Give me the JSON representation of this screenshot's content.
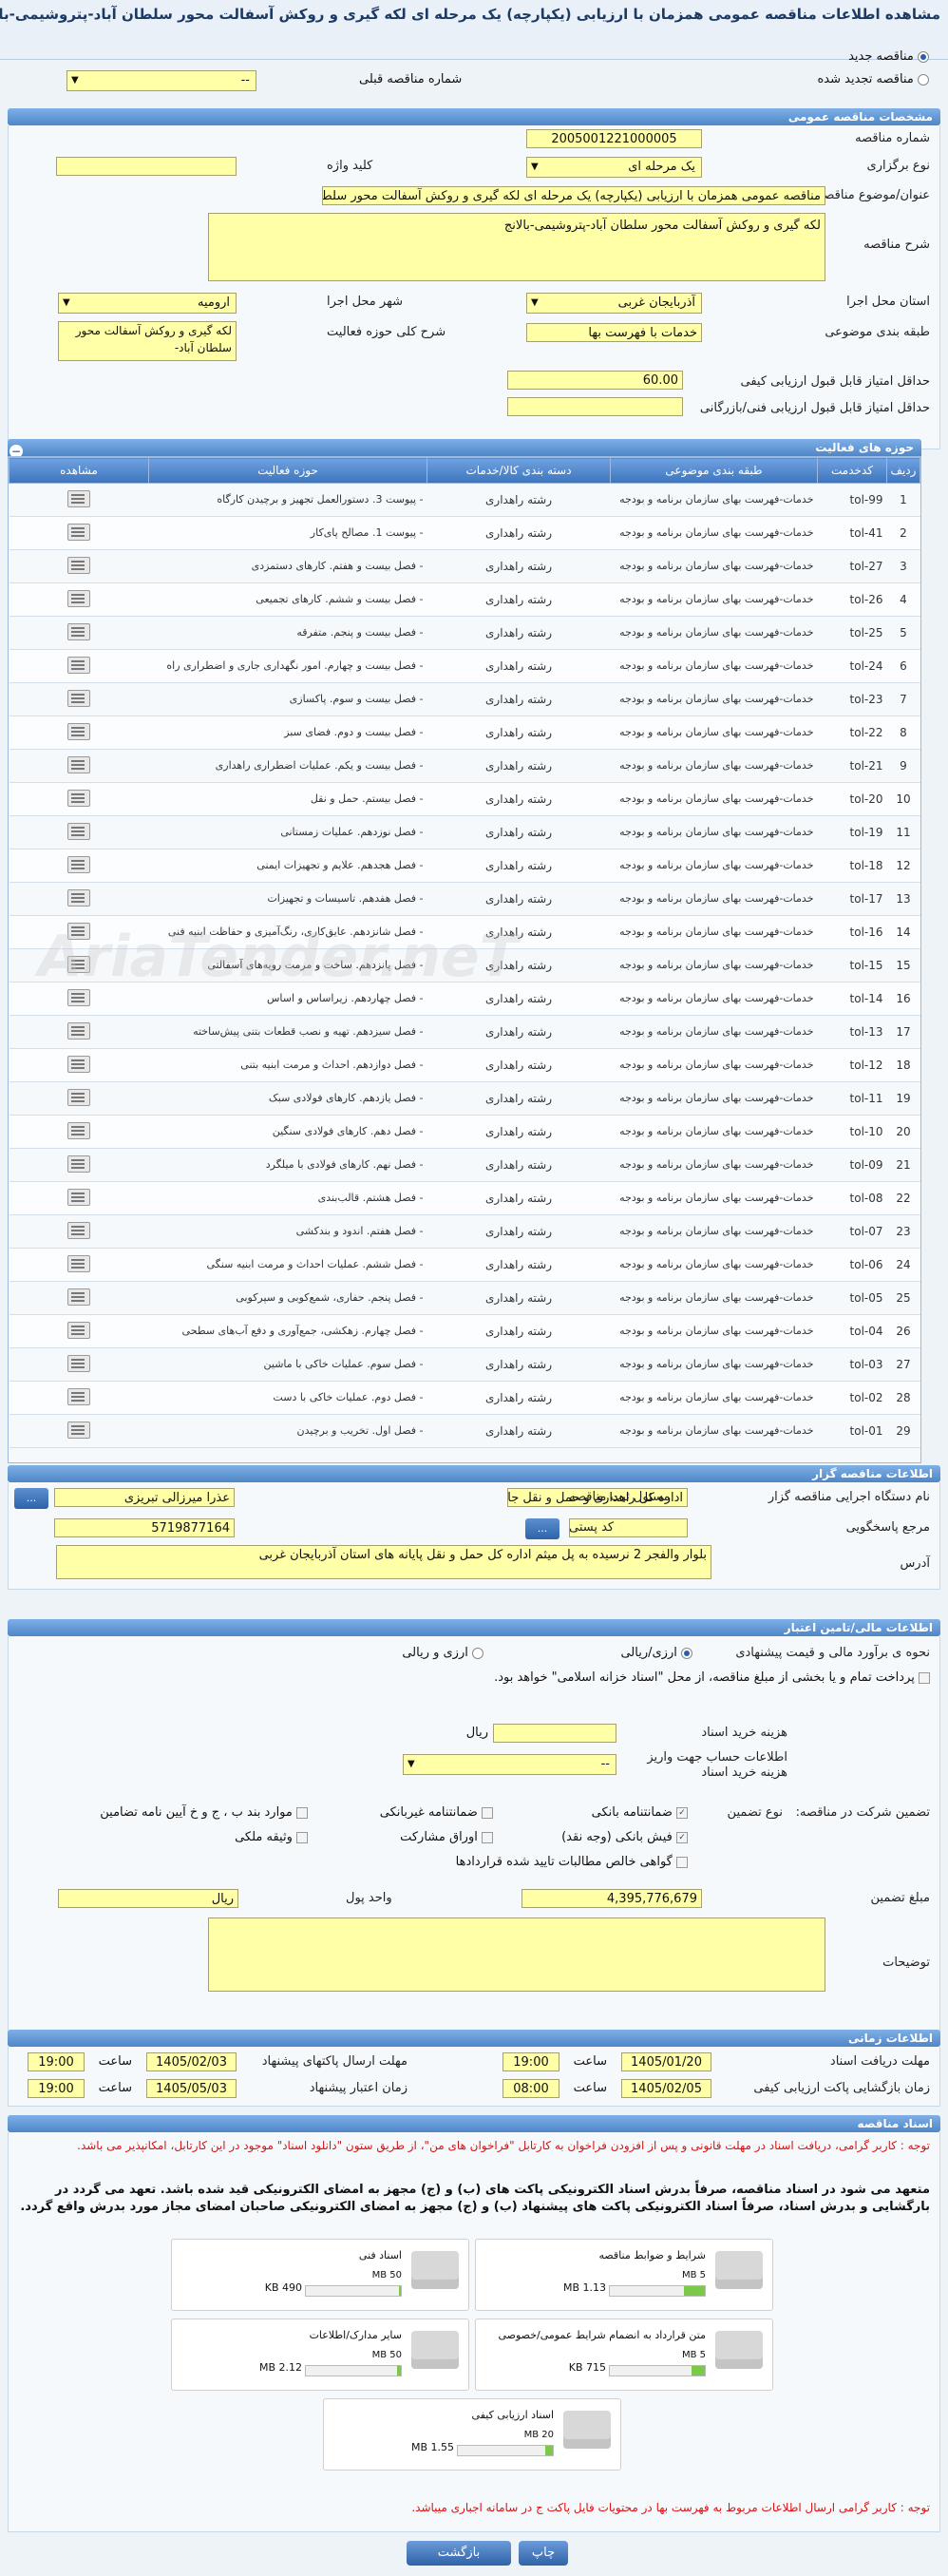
{
  "page_title": "مشاهده اطلاعات مناقصه عمومی همزمان با ارزیابی (یکپارچه) یک مرحله ای لکه گیری و روکش آسفالت محور سلطان آباد-پتروشیمی-بالانج",
  "top": {
    "new_tender_label": "مناقصه جدید",
    "renewed_tender_label": "مناقصه تجدید شده",
    "prev_tender_number_label": "شماره مناقصه قبلی",
    "prev_tender_value": "--"
  },
  "sections": {
    "general": "مشخصات مناقصه عمومی",
    "activities": "حوزه های فعالیت",
    "organizer": "اطلاعات مناقصه گزار",
    "financial": "اطلاعات مالی/تامین اعتبار",
    "timing": "اطلاعات زمانی",
    "docs": "اسناد مناقصه"
  },
  "general": {
    "tender_number_label": "شماره مناقصه",
    "tender_number": "2005001221000005",
    "holding_type_label": "نوع برگزاری",
    "holding_type": "یک مرحله ای",
    "keyword_label": "کلید واژه",
    "keyword": "",
    "subject_label": "عنوان/موضوع مناقصه",
    "subject": "مناقصه عمومی همزمان با ارزیابی (یکپارچه) یک مرحله ای لکه گیری و روکش آسفالت محور سلطان آباد-پتروشیمی-بالانج",
    "description_label": "شرح مناقصه",
    "description": "لکه گیری و روکش آسفالت محور سلطان آباد-پتروشیمی-بالانج",
    "province_label": "استان محل اجرا",
    "province": "آذربایجان غربی",
    "city_label": "شهر محل اجرا",
    "city": "ارومیه",
    "category_label": "طبقه بندی موضوعی",
    "category": "خدمات با فهرست بها",
    "scope_label": "شرح کلی حوزه فعالیت",
    "scope": "لکه گیری و روکش آسفالت محور سلطان آباد-",
    "min_quality_label": "حداقل امتیاز قابل قبول ارزیابی کیفی",
    "min_quality": "60.00",
    "min_tech_label": "حداقل امتیاز قابل قبول ارزیابی فنی/بازرگانی",
    "min_tech": ""
  },
  "activity_table": {
    "headers": [
      "ردیف",
      "کدخدمت",
      "طبقه بندی موضوعی",
      "دسته بندی کالا/خدمات",
      "حوزه فعالیت",
      "مشاهده"
    ],
    "rows": [
      [
        "1",
        "tol-99",
        "خدمات-فهرست بهای سازمان برنامه و بودجه",
        "رشته راهداری",
        "- پیوست 3. دستورالعمل تجهیز و برچیدن کارگاه"
      ],
      [
        "2",
        "tol-41",
        "خدمات-فهرست بهای سازمان برنامه و بودجه",
        "رشته راهداری",
        "- پیوست 1. مصالح پای‌کار"
      ],
      [
        "3",
        "tol-27",
        "خدمات-فهرست بهای سازمان برنامه و بودجه",
        "رشته راهداری",
        "- فصل بیست و هفتم. کارهای دستمزدی"
      ],
      [
        "4",
        "tol-26",
        "خدمات-فهرست بهای سازمان برنامه و بودجه",
        "رشته راهداری",
        "- فصل بیست و ششم. کارهای تجمیعی"
      ],
      [
        "5",
        "tol-25",
        "خدمات-فهرست بهای سازمان برنامه و بودجه",
        "رشته راهداری",
        "- فصل بیست و پنجم. متفرقه"
      ],
      [
        "6",
        "tol-24",
        "خدمات-فهرست بهای سازمان برنامه و بودجه",
        "رشته راهداری",
        "- فصل بیست و چهارم. امور نگهداری جاری و اضطراری راه"
      ],
      [
        "7",
        "tol-23",
        "خدمات-فهرست بهای سازمان برنامه و بودجه",
        "رشته راهداری",
        "- فصل بیست و سوم. پاکسازی"
      ],
      [
        "8",
        "tol-22",
        "خدمات-فهرست بهای سازمان برنامه و بودجه",
        "رشته راهداری",
        "- فصل بیست و دوم. فضای سبز"
      ],
      [
        "9",
        "tol-21",
        "خدمات-فهرست بهای سازمان برنامه و بودجه",
        "رشته راهداری",
        "- فصل بیست و یکم. عملیات اضطراری راهداری"
      ],
      [
        "10",
        "tol-20",
        "خدمات-فهرست بهای سازمان برنامه و بودجه",
        "رشته راهداری",
        "- فصل بیستم. حمل و نقل"
      ],
      [
        "11",
        "tol-19",
        "خدمات-فهرست بهای سازمان برنامه و بودجه",
        "رشته راهداری",
        "- فصل نوزدهم. عملیات زمستانی"
      ],
      [
        "12",
        "tol-18",
        "خدمات-فهرست بهای سازمان برنامه و بودجه",
        "رشته راهداری",
        "- فصل هجدهم. علایم و تجهیزات ایمنی"
      ],
      [
        "13",
        "tol-17",
        "خدمات-فهرست بهای سازمان برنامه و بودجه",
        "رشته راهداری",
        "- فصل هفدهم. تاسیسات و تجهیزات"
      ],
      [
        "14",
        "tol-16",
        "خدمات-فهرست بهای سازمان برنامه و بودجه",
        "رشته راهداری",
        "- فصل شانزدهم. عایق‌کاری، رنگ‌آمیزی و حفاظت ابنیه فنی"
      ],
      [
        "15",
        "tol-15",
        "خدمات-فهرست بهای سازمان برنامه و بودجه",
        "رشته راهداری",
        "- فصل پانزدهم. ساخت و مرمت رویه‌های آسفالتی"
      ],
      [
        "16",
        "tol-14",
        "خدمات-فهرست بهای سازمان برنامه و بودجه",
        "رشته راهداری",
        "- فصل چهاردهم. زیراساس و اساس"
      ],
      [
        "17",
        "tol-13",
        "خدمات-فهرست بهای سازمان برنامه و بودجه",
        "رشته راهداری",
        "- فصل سیزدهم. تهیه و نصب قطعات بتنی پیش‌ساخته"
      ],
      [
        "18",
        "tol-12",
        "خدمات-فهرست بهای سازمان برنامه و بودجه",
        "رشته راهداری",
        "- فصل دوازدهم. احداث و مرمت ابنیه بتنی"
      ],
      [
        "19",
        "tol-11",
        "خدمات-فهرست بهای سازمان برنامه و بودجه",
        "رشته راهداری",
        "- فصل یازدهم. کارهای فولادی سبک"
      ],
      [
        "20",
        "tol-10",
        "خدمات-فهرست بهای سازمان برنامه و بودجه",
        "رشته راهداری",
        "- فصل دهم. کارهای فولادی سنگین"
      ],
      [
        "21",
        "tol-09",
        "خدمات-فهرست بهای سازمان برنامه و بودجه",
        "رشته راهداری",
        "- فصل نهم. کارهای فولادی با میلگرد"
      ],
      [
        "22",
        "tol-08",
        "خدمات-فهرست بهای سازمان برنامه و بودجه",
        "رشته راهداری",
        "- فصل هشتم. قالب‌بندی"
      ],
      [
        "23",
        "tol-07",
        "خدمات-فهرست بهای سازمان برنامه و بودجه",
        "رشته راهداری",
        "- فصل هفتم. اندود و بندکشی"
      ],
      [
        "24",
        "tol-06",
        "خدمات-فهرست بهای سازمان برنامه و بودجه",
        "رشته راهداری",
        "- فصل ششم. عملیات احداث و مرمت ابنیه سنگی"
      ],
      [
        "25",
        "tol-05",
        "خدمات-فهرست بهای سازمان برنامه و بودجه",
        "رشته راهداری",
        "- فصل پنجم. حفاری، شمع‌کوبی و سپرکوبی"
      ],
      [
        "26",
        "tol-04",
        "خدمات-فهرست بهای سازمان برنامه و بودجه",
        "رشته راهداری",
        "- فصل چهارم. زهکشی، جمع‌آوری و دفع آب‌های سطحی"
      ],
      [
        "27",
        "tol-03",
        "خدمات-فهرست بهای سازمان برنامه و بودجه",
        "رشته راهداری",
        "- فصل سوم. عملیات خاکی با ماشین"
      ],
      [
        "28",
        "tol-02",
        "خدمات-فهرست بهای سازمان برنامه و بودجه",
        "رشته راهداری",
        "- فصل دوم. عملیات خاکی با دست"
      ],
      [
        "29",
        "tol-01",
        "خدمات-فهرست بهای سازمان برنامه و بودجه",
        "رشته راهداری",
        "- فصل اول. تخریب و برچیدن"
      ]
    ]
  },
  "organizer": {
    "org_label": "نام دستگاه اجرایی مناقصه گزار",
    "org": "اداره کل راهداری و حمل و نقل جاده ای استان آذربایجان غربی",
    "responsible_label": "مسئول ثبت مناقصه",
    "responsible": "عذرا میرزالی تبریزی",
    "ref_label": "مرجع پاسخگویی",
    "ref": "",
    "postal_label": "کد پستی",
    "postal": "5719877164",
    "address_label": "آدرس",
    "address": "بلوار والفجر 2 نرسیده به پل میثم اداره کل حمل و نقل پایانه های استان آذربایجان غربی",
    "dots": "..."
  },
  "financial": {
    "estimate_label": "نحوه ی برآورد مالی و قیمت پیشنهادی",
    "estimate_opt1": "ارزی/ریالی",
    "estimate_opt2": "ارزی و ریالی",
    "full_payment": "پرداخت تمام و یا بخشی از مبلغ مناقصه، از محل \"اسناد خزانه اسلامی\" خواهد بود.",
    "doc_fee_label": "هزینه خرید اسناد",
    "doc_fee_unit": "ریال",
    "account_label": "اطلاعات حساب جهت واریز هزینه خرید اسناد",
    "account_value": "--",
    "guarantee_type_label": "نوع تضمین",
    "participation_label": "تضمین شرکت در مناقصه:",
    "opt_bank_guarantee": "ضمانتنامه بانکی",
    "opt_nonbank_guarantee": "ضمانتنامه غیربانکی",
    "opt_clauses": "موارد بند ب ، ج و خ آیین نامه تضامین",
    "opt_bank_receipt": "فیش بانکی (وجه نقد)",
    "opt_bonds": "اوراق مشارکت",
    "opt_property": "وثیقه ملکی",
    "opt_certified_claims": "گواهی خالص مطالبات تایید شده قراردادها",
    "amount_label": "مبلغ تضمین",
    "amount": "4,395,776,679",
    "currency_label": "واحد پول",
    "currency": "ریال",
    "notes_label": "توضیحات",
    "notes": ""
  },
  "timing": {
    "receive_docs_label": "مهلت دریافت اسناد",
    "receive_docs_date": "1405/01/20",
    "receive_docs_time": "19:00",
    "send_offers_label": "مهلت ارسال پاکتهای پیشنهاد",
    "send_offers_date": "1405/02/03",
    "send_offers_time": "19:00",
    "open_quality_label": "زمان بازگشایی پاکت ارزیابی کیفی",
    "open_quality_date": "1405/02/05",
    "open_quality_time": "08:00",
    "validity_label": "زمان اعتبار پیشنهاد",
    "validity_date": "1405/05/03",
    "validity_time": "19:00",
    "time_label": "ساعت"
  },
  "docs": {
    "note1": "توجه : کاربر گرامی، دریافت اسناد در مهلت قانونی و پس از افزودن فراخوان به کارتابل \"فراخوان های من\"، از طریق ستون \"دانلود اسناد\" موجود در این کارتابل، امکانپذیر می باشد.",
    "note2": "متعهد می شود در اسناد مناقصه، صرفاً بدرش اسناد الکترونیکی پاکت های (ب) و (ج) مجهز به امضای الکترونیکی قید شده باشد. تعهد می گردد در بارگشایی و بدرش اسناد، صرفاً اسناد الکترونیکی پاکت های پیشنهاد (ب) و (ج) مجهز به امضای الکترونیکی صاحبان امضای مجاز مورد بدرش واقع گردد.",
    "cards": [
      {
        "name": "شرایط و ضوابط مناقصه",
        "size": "1.13 MB",
        "max": "5 MB",
        "ratio": 0.22
      },
      {
        "name": "اسناد فنی",
        "size": "490 KB",
        "max": "50 MB",
        "ratio": 0.01
      },
      {
        "name": "متن قرارداد به انضمام شرایط عمومی/خصوصی",
        "size": "715 KB",
        "max": "5 MB",
        "ratio": 0.14
      },
      {
        "name": "سایر مدارک/اطلاعات",
        "size": "2.12 MB",
        "max": "50 MB",
        "ratio": 0.04
      },
      {
        "name": "اسناد ارزیابی کیفی",
        "size": "1.55 MB",
        "max": "20 MB",
        "ratio": 0.08
      }
    ],
    "note3": "توجه : کاربر گرامی ارسال اطلاعات مربوط به فهرست بها در محتویات فایل پاکت ج در سامانه اجباری میباشد."
  },
  "footer": {
    "print_label": "چاپ",
    "back_label": "بازگشت"
  }
}
